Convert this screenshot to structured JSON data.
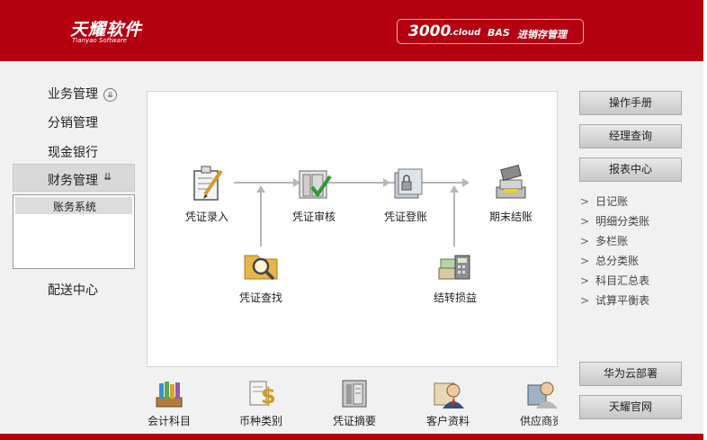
{
  "header": {
    "logo_cn": "天耀软件",
    "logo_en": "Tianyao Software",
    "product_num": "3000",
    "product_cloud": ".cloud",
    "product_bas": "BAS",
    "product_name": "进销存管理"
  },
  "sidebar": {
    "items": [
      {
        "label": "业务管理",
        "chevron": "⇊"
      },
      {
        "label": "分销管理"
      },
      {
        "label": "现金银行"
      },
      {
        "label": "财务管理",
        "chevron": "⇊"
      },
      {
        "label": "配送中心"
      }
    ],
    "sub_items": [
      "账务系统"
    ]
  },
  "flow": {
    "nodes": [
      {
        "label": "凭证录入",
        "icon": "voucher-entry-icon"
      },
      {
        "label": "凭证审核",
        "icon": "voucher-audit-icon"
      },
      {
        "label": "凭证登账",
        "icon": "voucher-posting-icon"
      },
      {
        "label": "期末结账",
        "icon": "period-closing-icon"
      },
      {
        "label": "凭证查找",
        "icon": "voucher-search-icon"
      },
      {
        "label": "结转损益",
        "icon": "profit-loss-transfer-icon"
      }
    ]
  },
  "right_panel": {
    "top_buttons": [
      "操作手册",
      "经理查询",
      "报表中心"
    ],
    "report_links": [
      "日记账",
      "明细分类账",
      "多栏账",
      "总分类账",
      "科目汇总表",
      "试算平衡表"
    ],
    "bottom_buttons": [
      "华为云部署",
      "天耀官网"
    ]
  },
  "bottom_shortcuts": [
    {
      "label": "会计科目",
      "icon": "accounting-subjects-icon"
    },
    {
      "label": "币种类别",
      "icon": "currency-type-icon"
    },
    {
      "label": "凭证摘要",
      "icon": "voucher-summary-icon"
    },
    {
      "label": "客户资料",
      "icon": "customer-info-icon"
    },
    {
      "label": "供应商资",
      "icon": "supplier-info-icon"
    }
  ],
  "colors": {
    "brand_red": "#b40010",
    "panel_bg": "#f1f1f1"
  }
}
